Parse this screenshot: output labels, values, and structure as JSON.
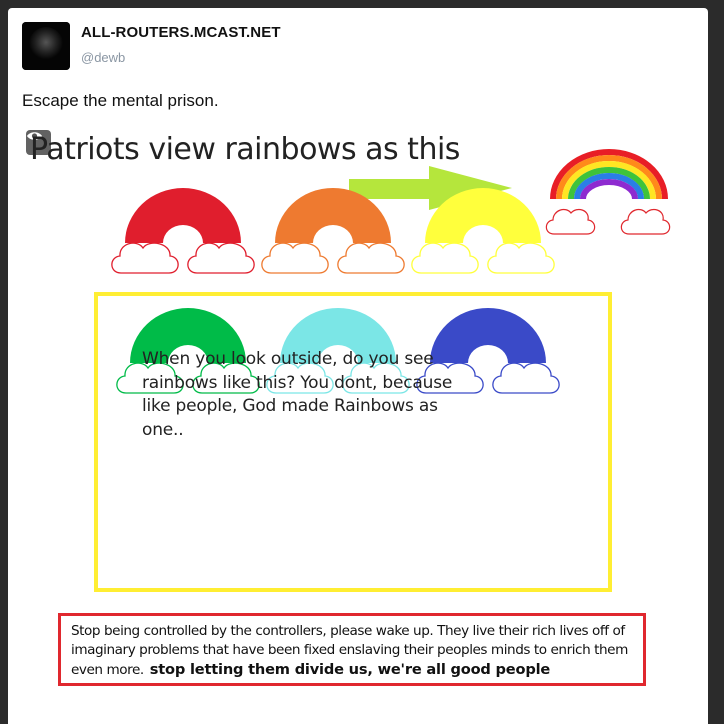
{
  "post": {
    "display_name": "ALL-ROUTERS.MCAST.NET",
    "handle": "@dewb",
    "text": "Escape the mental prison."
  },
  "media": {
    "sensitive_icon": "eye-icon",
    "headline": "Patriots view rainbows as this",
    "arrow_color": "#b5e63c",
    "caption": "When you look outside, do you see rainbows like this? You dont, because like people, God made Rainbows as one..",
    "rainbow_colors": [
      "#e01e2d",
      "#ee7a30",
      "#ffff3c",
      "#00bb48",
      "#7be6e6",
      "#3a4ac8"
    ],
    "box_border_color": "#ffee33",
    "notice_border_color": "#e0282e",
    "notice_text": "Stop being controlled by the controllers, please wake up. They live their rich lives off of imaginary problems that have been fixed enslaving their peoples minds to enrich them even more.",
    "notice_bold": "stop letting them divide us, we're all good people"
  }
}
